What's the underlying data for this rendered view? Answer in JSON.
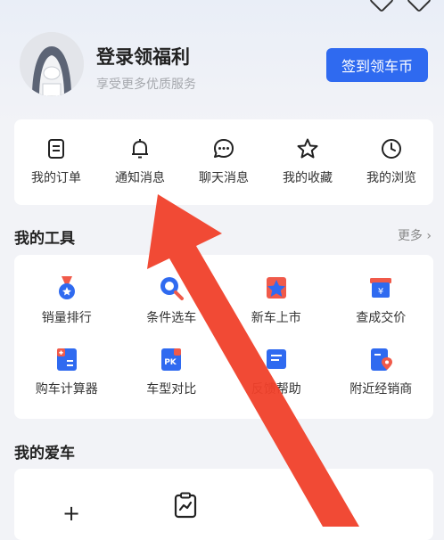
{
  "profile": {
    "title": "登录领福利",
    "subtitle": "享受更多优质服务",
    "signin_label": "签到领车币"
  },
  "shortcuts": [
    {
      "label": "我的订单",
      "icon": "order-icon"
    },
    {
      "label": "通知消息",
      "icon": "bell-icon"
    },
    {
      "label": "聊天消息",
      "icon": "chat-icon"
    },
    {
      "label": "我的收藏",
      "icon": "star-icon"
    },
    {
      "label": "我的浏览",
      "icon": "clock-icon"
    }
  ],
  "tools_section": {
    "title": "我的工具",
    "more_label": "更多 ›",
    "items": [
      {
        "label": "销量排行",
        "icon": "medal-icon"
      },
      {
        "label": "条件选车",
        "icon": "magnifier-icon"
      },
      {
        "label": "新车上市",
        "icon": "star-badge-icon"
      },
      {
        "label": "查成交价",
        "icon": "price-tag-icon"
      },
      {
        "label": "购车计算器",
        "icon": "calculator-icon"
      },
      {
        "label": "车型对比",
        "icon": "pk-icon"
      },
      {
        "label": "反馈帮助",
        "icon": "feedback-icon"
      },
      {
        "label": "附近经销商",
        "icon": "location-icon"
      }
    ]
  },
  "car_section": {
    "title": "我的爱车",
    "add_label": "+"
  },
  "colors": {
    "accent": "#2f6af0",
    "annotation_arrow": "#f0402a"
  }
}
